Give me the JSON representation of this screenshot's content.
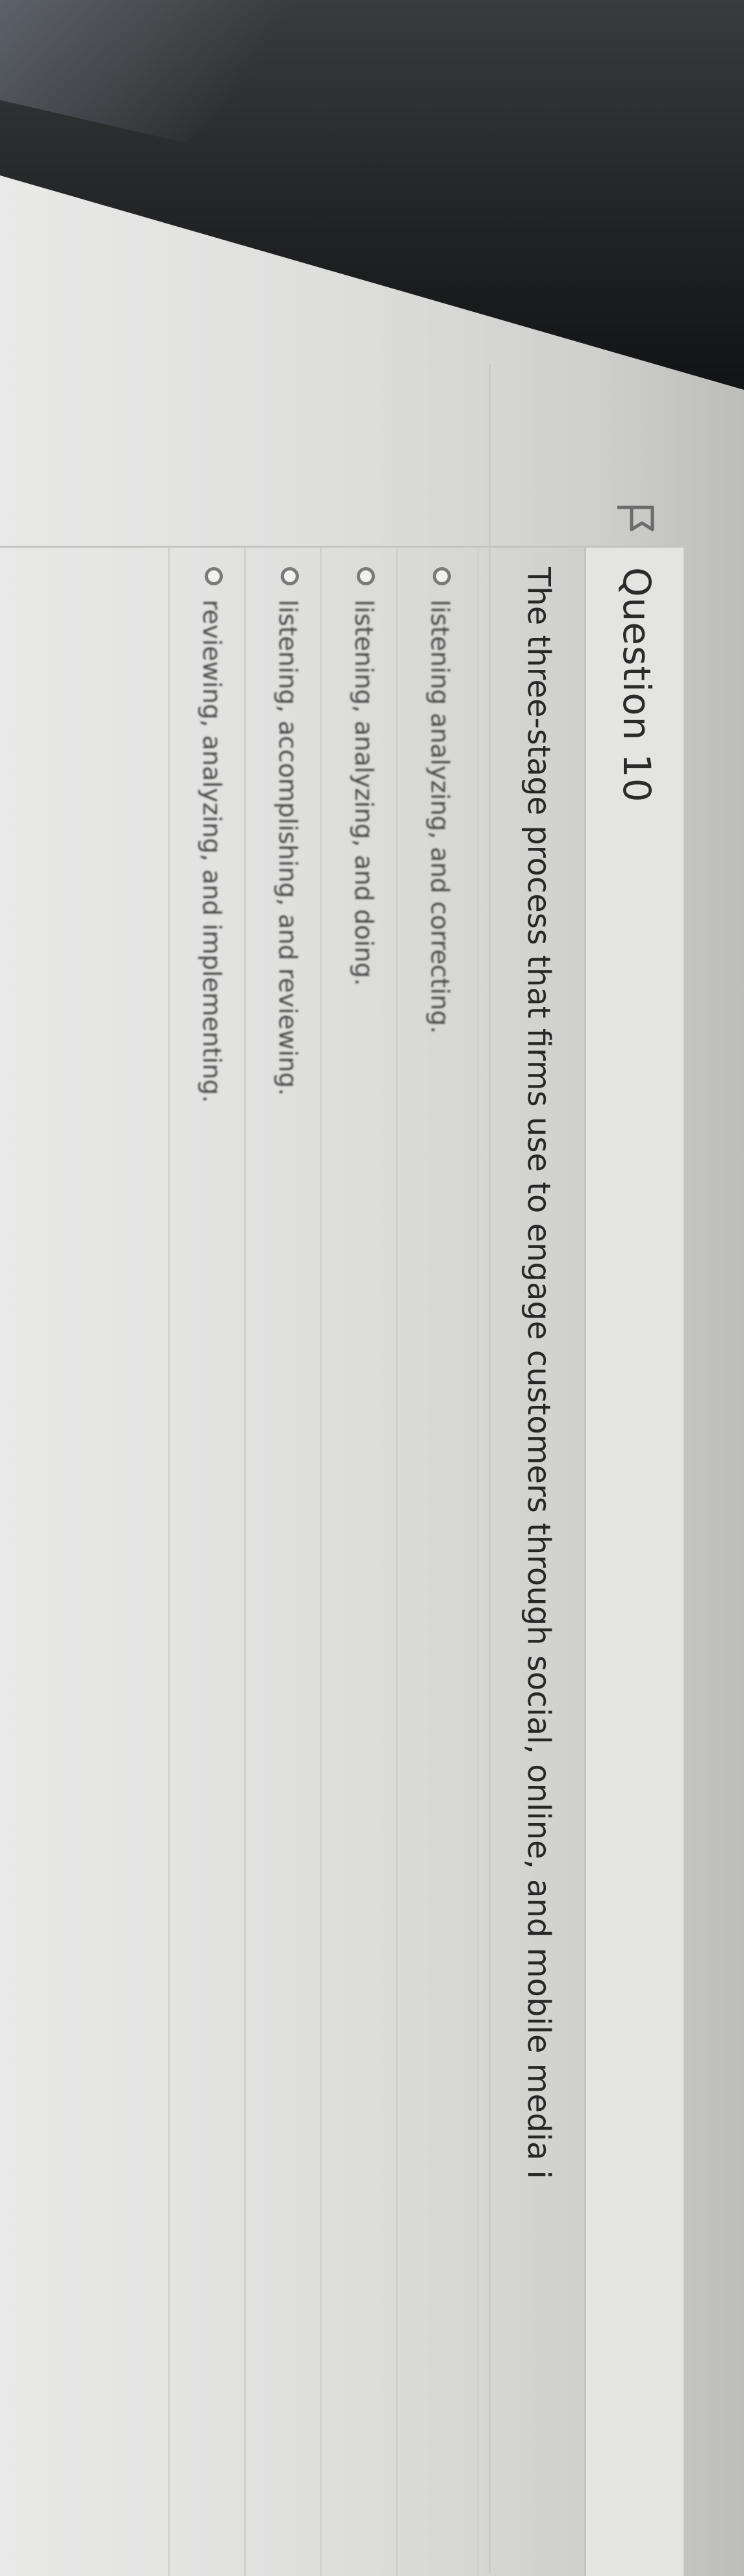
{
  "question": {
    "title": "Question 10",
    "text": "The three-stage process that firms use to engage customers through social, online, and mobile media i"
  },
  "answers": [
    {
      "label": "listening analyzing, and correcting."
    },
    {
      "label": "listening, analyzing, and doing."
    },
    {
      "label": "listening, accomplishing, and reviewing."
    },
    {
      "label": "reviewing, analyzing, and implementing."
    }
  ],
  "icons": {
    "flag": "flag-icon",
    "radio": "radio-unchecked-icon"
  },
  "colors": {
    "page_background": "#dedfdd",
    "bezel": "#1f2022",
    "text": "#272727",
    "rule": "#c4c4c2",
    "radio_border": "#7a7a7a"
  }
}
